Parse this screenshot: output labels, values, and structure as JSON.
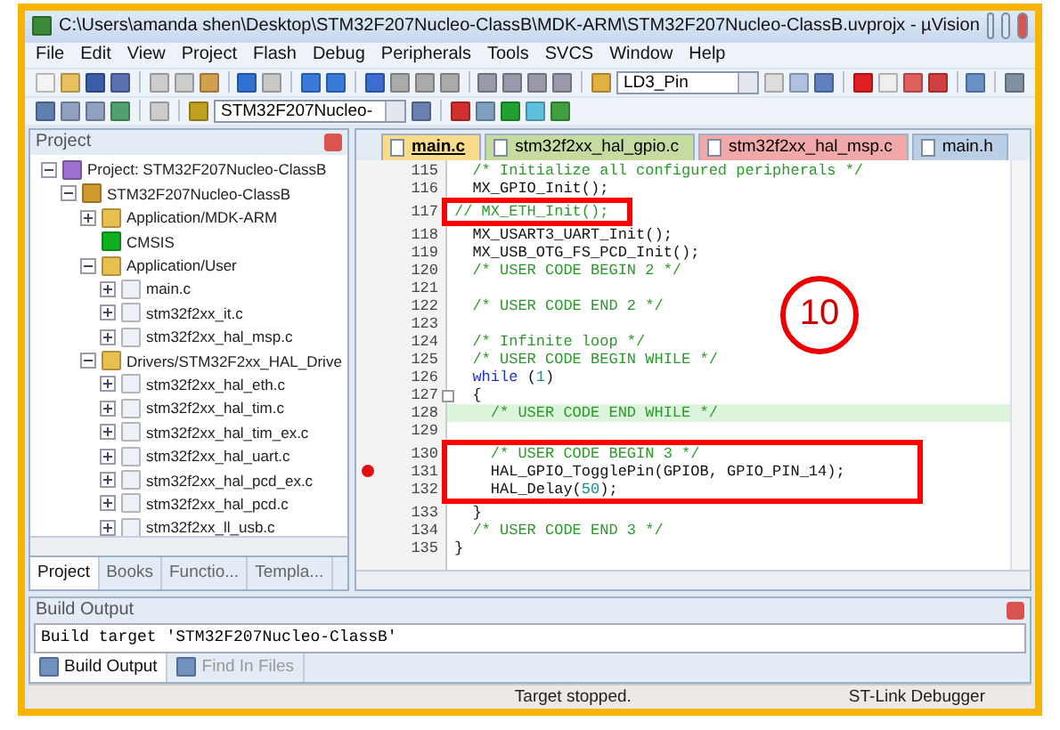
{
  "window": {
    "title": "C:\\Users\\amanda shen\\Desktop\\STM32F207Nucleo-ClassB\\MDK-ARM\\STM32F207Nucleo-ClassB.uvprojx - µVision"
  },
  "menu": [
    "File",
    "Edit",
    "View",
    "Project",
    "Flash",
    "Debug",
    "Peripherals",
    "Tools",
    "SVCS",
    "Window",
    "Help"
  ],
  "toolbar": {
    "find_value": "LD3_Pin",
    "target_value": "STM32F207Nucleo-"
  },
  "project_panel": {
    "title": "Project",
    "tree": [
      {
        "label": "Project: STM32F207Nucleo-ClassB",
        "kind": "project",
        "expanded": true,
        "children": [
          {
            "label": "STM32F207Nucleo-ClassB",
            "kind": "target",
            "expanded": true,
            "children": [
              {
                "label": "Application/MDK-ARM",
                "kind": "folder",
                "expanded": false
              },
              {
                "label": "CMSIS",
                "kind": "component"
              },
              {
                "label": "Application/User",
                "kind": "folder",
                "expanded": true,
                "children": [
                  {
                    "label": "main.c",
                    "kind": "file",
                    "expanded": false
                  },
                  {
                    "label": "stm32f2xx_it.c",
                    "kind": "file",
                    "expanded": false
                  },
                  {
                    "label": "stm32f2xx_hal_msp.c",
                    "kind": "file",
                    "expanded": false
                  }
                ]
              },
              {
                "label": "Drivers/STM32F2xx_HAL_Drive",
                "kind": "folder",
                "expanded": true,
                "children": [
                  {
                    "label": "stm32f2xx_hal_eth.c",
                    "kind": "file",
                    "expanded": false
                  },
                  {
                    "label": "stm32f2xx_hal_tim.c",
                    "kind": "file",
                    "expanded": false
                  },
                  {
                    "label": "stm32f2xx_hal_tim_ex.c",
                    "kind": "file",
                    "expanded": false
                  },
                  {
                    "label": "stm32f2xx_hal_uart.c",
                    "kind": "file",
                    "expanded": false
                  },
                  {
                    "label": "stm32f2xx_hal_pcd_ex.c",
                    "kind": "file",
                    "expanded": false
                  },
                  {
                    "label": "stm32f2xx_hal_pcd.c",
                    "kind": "file",
                    "expanded": false
                  },
                  {
                    "label": "stm32f2xx_ll_usb.c",
                    "kind": "file",
                    "expanded": false
                  }
                ]
              }
            ]
          }
        ]
      }
    ],
    "tabs": [
      {
        "label": "Project",
        "selected": true
      },
      {
        "label": "Books",
        "selected": false
      },
      {
        "label": "Functio...",
        "selected": false
      },
      {
        "label": "Templa...",
        "selected": false
      }
    ]
  },
  "editor": {
    "tabs": [
      {
        "label": "main.c",
        "selected": true,
        "color": "#f9dc8a"
      },
      {
        "label": "stm32f2xx_hal_gpio.c",
        "selected": false,
        "color": "#c6dba0"
      },
      {
        "label": "stm32f2xx_hal_msp.c",
        "selected": false,
        "color": "#f2a8a8"
      },
      {
        "label": "main.h",
        "selected": false,
        "color": "#b8cfe6"
      }
    ],
    "lines": [
      {
        "number": "115",
        "parts": [
          {
            "kind": "comment",
            "text": "  /* Initialize all configured peripherals */"
          }
        ]
      },
      {
        "number": "116",
        "parts": [
          {
            "kind": "code",
            "text": "  MX_GPIO_Init();"
          }
        ]
      },
      {
        "number": "117",
        "boxed": true,
        "parts": [
          {
            "kind": "comment",
            "text": "// MX_ETH_Init();"
          }
        ]
      },
      {
        "number": "118",
        "parts": [
          {
            "kind": "code",
            "text": "  MX_USART3_UART_Init();"
          }
        ]
      },
      {
        "number": "119",
        "parts": [
          {
            "kind": "code",
            "text": "  MX_USB_OTG_FS_PCD_Init();"
          }
        ]
      },
      {
        "number": "120",
        "parts": [
          {
            "kind": "comment",
            "text": "  /* USER CODE BEGIN 2 */"
          }
        ]
      },
      {
        "number": "121"
      },
      {
        "number": "122",
        "parts": [
          {
            "kind": "comment",
            "text": "  /* USER CODE END 2 */"
          }
        ]
      },
      {
        "number": "123"
      },
      {
        "number": "124",
        "parts": [
          {
            "kind": "comment",
            "text": "  /* Infinite loop */"
          }
        ]
      },
      {
        "number": "125",
        "parts": [
          {
            "kind": "comment",
            "text": "  /* USER CODE BEGIN WHILE */"
          }
        ]
      },
      {
        "number": "126",
        "parts": [
          {
            "kind": "keyword",
            "text": "  while"
          },
          {
            "kind": "code",
            "text": " ("
          },
          {
            "kind": "number",
            "text": "1"
          },
          {
            "kind": "code",
            "text": ")"
          }
        ]
      },
      {
        "number": "127",
        "fold": true,
        "parts": [
          {
            "kind": "code",
            "text": "  {"
          }
        ]
      },
      {
        "number": "128",
        "highlighted": true,
        "parts": [
          {
            "kind": "comment",
            "text": "    /* USER CODE END WHILE */"
          }
        ]
      },
      {
        "number": "129"
      },
      {
        "number": "130",
        "boxed": true,
        "parts": [
          {
            "kind": "comment",
            "text": "    /* USER CODE BEGIN 3 */"
          }
        ]
      },
      {
        "number": "131",
        "boxed": true,
        "breakpoint": true,
        "parts": [
          {
            "kind": "code",
            "text": "    HAL_GPIO_TogglePin(GPIOB, GPIO_PIN_14);"
          }
        ]
      },
      {
        "number": "132",
        "boxed": true,
        "parts": [
          {
            "kind": "code",
            "text": "    HAL_Delay("
          },
          {
            "kind": "number",
            "text": "50"
          },
          {
            "kind": "code",
            "text": ");"
          }
        ]
      },
      {
        "number": "133",
        "parts": [
          {
            "kind": "code",
            "text": "  }"
          }
        ]
      },
      {
        "number": "134",
        "parts": [
          {
            "kind": "comment",
            "text": "  /* USER CODE END 3 */"
          }
        ]
      },
      {
        "number": "135",
        "parts": [
          {
            "kind": "code",
            "text": "}"
          }
        ]
      }
    ]
  },
  "annotation": {
    "step": "10"
  },
  "build_output": {
    "title": "Build Output",
    "text": "Build target 'STM32F207Nucleo-ClassB'",
    "tabs": [
      {
        "label": "Build Output",
        "selected": true,
        "disabled": false
      },
      {
        "label": "Find In Files",
        "selected": false,
        "disabled": true
      }
    ]
  },
  "status_bar": {
    "message": "Target stopped.",
    "debugger": "ST-Link Debugger"
  }
}
